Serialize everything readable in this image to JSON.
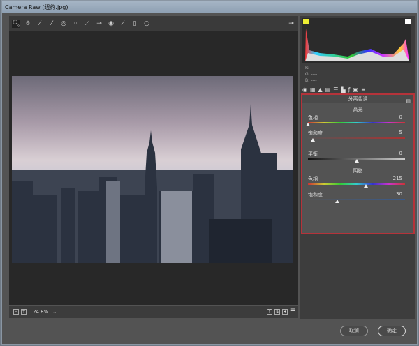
{
  "window": {
    "title": "Camera Raw (纽约.jpg)"
  },
  "toolbar": {
    "tools": [
      "zoom-icon",
      "hand-icon",
      "white-balance-icon",
      "color-sampler-icon",
      "target-adjust-icon",
      "crop-icon",
      "straighten-icon",
      "spot-removal-icon",
      "red-eye-icon",
      "adjustment-brush-icon",
      "graduated-filter-icon",
      "radial-filter-icon"
    ],
    "open_prefs": "open-preferences-icon"
  },
  "histogram": {
    "r": "R:",
    "g": "G:",
    "b": "B:",
    "r_val": "----",
    "g_val": "----",
    "b_val": "----"
  },
  "panel": {
    "title": "分离色调",
    "highlights": {
      "label": "高光",
      "hue": {
        "label": "色相",
        "value": "0",
        "fraction": 0
      },
      "saturation": {
        "label": "饱和度",
        "value": "5",
        "fraction": 0.05
      }
    },
    "balance": {
      "label": "平衡",
      "value": "0",
      "fraction": 0.5
    },
    "shadows": {
      "label": "阴影",
      "hue": {
        "label": "色相",
        "value": "215",
        "fraction": 0.6
      },
      "saturation": {
        "label": "饱和度",
        "value": "30",
        "fraction": 0.3
      }
    }
  },
  "bottom": {
    "zoom": "24.8%"
  },
  "buttons": {
    "cancel": "取消",
    "ok": "确定"
  }
}
